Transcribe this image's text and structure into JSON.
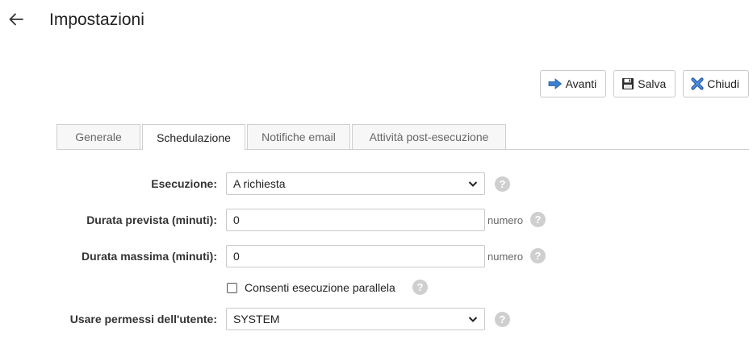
{
  "header": {
    "title": "Impostazioni"
  },
  "toolbar": {
    "next_label": "Avanti",
    "save_label": "Salva",
    "close_label": "Chiudi"
  },
  "tabs": [
    {
      "label": "Generale",
      "active": false
    },
    {
      "label": "Schedulazione",
      "active": true
    },
    {
      "label": "Notifiche email",
      "active": false
    },
    {
      "label": "Attività post-esecuzione",
      "active": false
    }
  ],
  "form": {
    "execution": {
      "label": "Esecuzione:",
      "value": "A richiesta"
    },
    "expected_duration": {
      "label": "Durata prevista (minuti):",
      "value": "0",
      "unit": "numero"
    },
    "max_duration": {
      "label": "Durata massima (minuti):",
      "value": "0",
      "unit": "numero"
    },
    "parallel": {
      "label": "Consenti esecuzione parallela",
      "checked": false
    },
    "user_permissions": {
      "label": "Usare permessi dell'utente:",
      "value": "SYSTEM"
    }
  },
  "help_glyph": "?",
  "colors": {
    "next_icon": "#3b7fd0",
    "close_icon": "#2a63b8",
    "help_bg": "#cfcfcf",
    "border": "#c9c9c9"
  }
}
